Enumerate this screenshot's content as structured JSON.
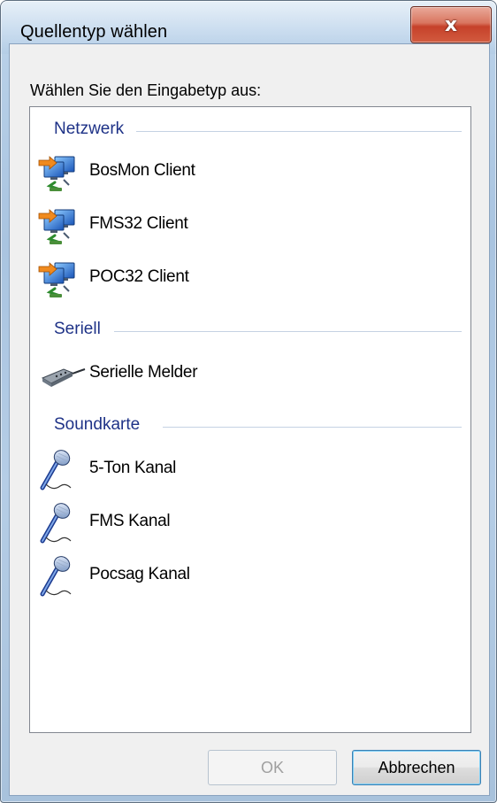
{
  "window": {
    "title": "Quellentyp wählen",
    "close_glyph": "x"
  },
  "dialog": {
    "prompt": "Wählen Sie den Eingabetyp aus:"
  },
  "groups": [
    {
      "title": "Netzwerk",
      "items": [
        {
          "label": "BosMon Client",
          "icon": "network-client-icon"
        },
        {
          "label": "FMS32 Client",
          "icon": "network-client-icon"
        },
        {
          "label": "POC32 Client",
          "icon": "network-client-icon"
        }
      ]
    },
    {
      "title": "Seriell",
      "items": [
        {
          "label": "Serielle Melder",
          "icon": "serial-cable-icon"
        }
      ]
    },
    {
      "title": "Soundkarte",
      "items": [
        {
          "label": "5-Ton Kanal",
          "icon": "microphone-icon"
        },
        {
          "label": "FMS Kanal",
          "icon": "microphone-icon"
        },
        {
          "label": "Pocsag Kanal",
          "icon": "microphone-icon"
        }
      ]
    }
  ],
  "buttons": {
    "ok_label": "OK",
    "ok_enabled": false,
    "cancel_label": "Abbrechen"
  }
}
